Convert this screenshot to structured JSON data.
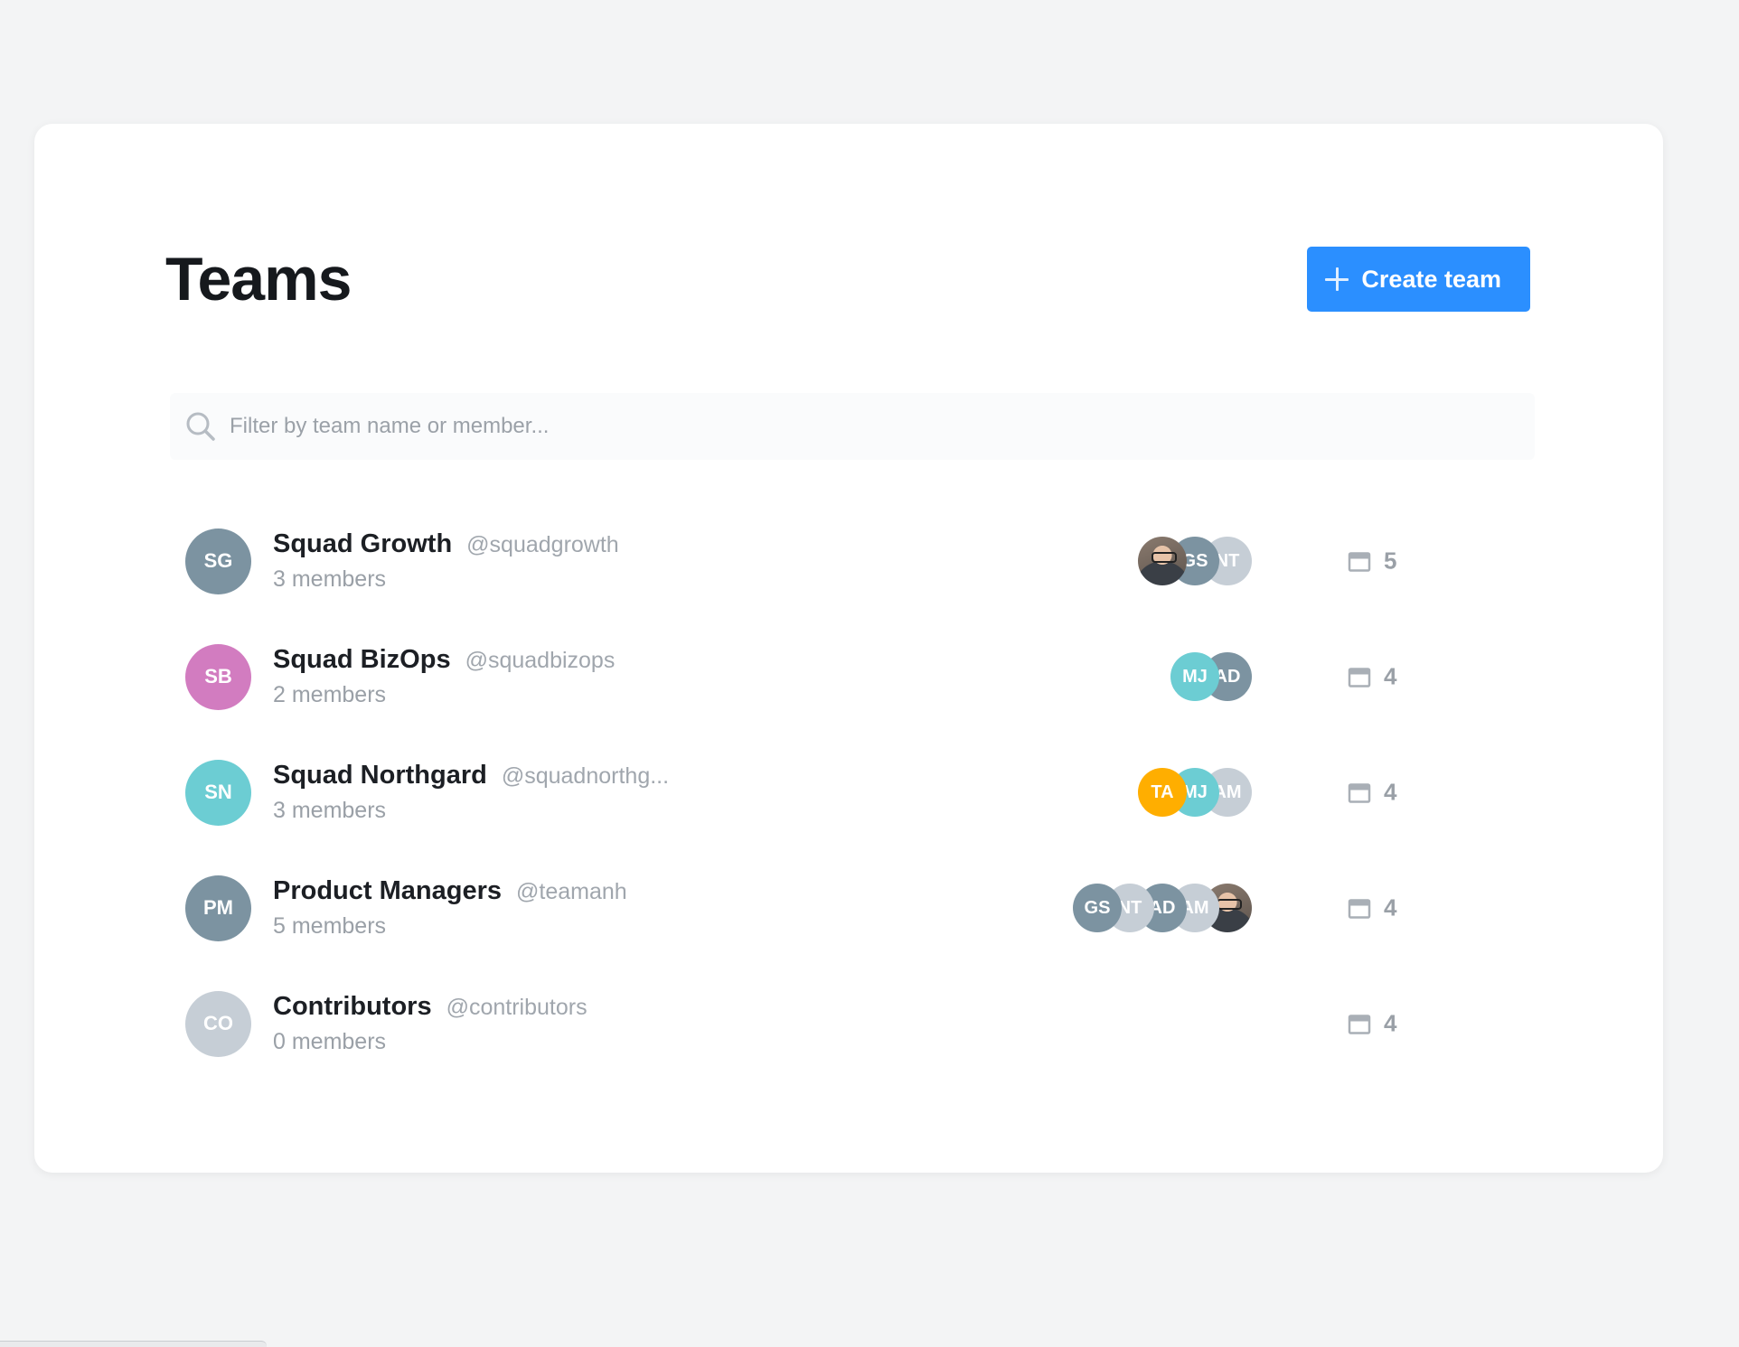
{
  "header": {
    "title": "Teams",
    "create_label": "Create team"
  },
  "search": {
    "placeholder": "Filter by team name or member..."
  },
  "colors": {
    "accent": "#2b8fff",
    "slate": "#7c93a1",
    "pink": "#d27cc0",
    "teal": "#6ccdd3",
    "light_gray": "#c6ced6",
    "orange": "#ffae00"
  },
  "teams": [
    {
      "initials": "SG",
      "name": "Squad Growth",
      "handle": "@squadgrowth",
      "members_text": "3 members",
      "repos": "5",
      "avatar_color": "#7c93a1",
      "member_avatars": [
        {
          "type": "photo",
          "initials": ""
        },
        {
          "type": "initials",
          "initials": "GS",
          "color": "#7c93a1"
        },
        {
          "type": "initials",
          "initials": "NT",
          "color": "#c6ced6"
        }
      ]
    },
    {
      "initials": "SB",
      "name": "Squad BizOps",
      "handle": "@squadbizops",
      "members_text": "2 members",
      "repos": "4",
      "avatar_color": "#d27cc0",
      "member_avatars": [
        {
          "type": "initials",
          "initials": "MJ",
          "color": "#6ccdd3"
        },
        {
          "type": "initials",
          "initials": "AD",
          "color": "#7c93a1"
        }
      ]
    },
    {
      "initials": "SN",
      "name": "Squad Northgard",
      "handle": "@squadnorthg...",
      "members_text": "3 members",
      "repos": "4",
      "avatar_color": "#6ccdd3",
      "member_avatars": [
        {
          "type": "initials",
          "initials": "TA",
          "color": "#ffae00"
        },
        {
          "type": "initials",
          "initials": "MJ",
          "color": "#6ccdd3"
        },
        {
          "type": "initials",
          "initials": "AM",
          "color": "#c6ced6"
        }
      ]
    },
    {
      "initials": "PM",
      "name": "Product Managers",
      "handle": "@teamanh",
      "members_text": "5 members",
      "repos": "4",
      "avatar_color": "#7c93a1",
      "member_avatars": [
        {
          "type": "initials",
          "initials": "GS",
          "color": "#7c93a1"
        },
        {
          "type": "initials",
          "initials": "NT",
          "color": "#c6ced6"
        },
        {
          "type": "initials",
          "initials": "AD",
          "color": "#7c93a1"
        },
        {
          "type": "initials",
          "initials": "AM",
          "color": "#c6ced6"
        },
        {
          "type": "photo",
          "initials": ""
        }
      ]
    },
    {
      "initials": "CO",
      "name": "Contributors",
      "handle": "@contributors",
      "members_text": "0 members",
      "repos": "4",
      "avatar_color": "#c6ced6",
      "member_avatars": []
    }
  ]
}
